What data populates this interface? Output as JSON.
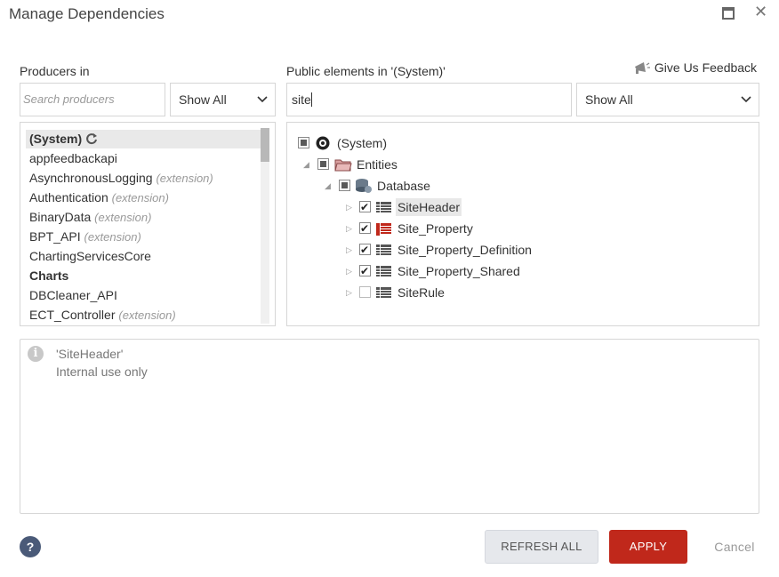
{
  "window": {
    "title": "Manage Dependencies"
  },
  "producers": {
    "label": "Producers in",
    "search_placeholder": "Search producers",
    "filter": "Show All",
    "items": [
      {
        "name": "(System)",
        "ext": ""
      },
      {
        "name": "appfeedbackapi",
        "ext": ""
      },
      {
        "name": "AsynchronousLogging",
        "ext": "(extension)"
      },
      {
        "name": "Authentication",
        "ext": "(extension)"
      },
      {
        "name": "BinaryData",
        "ext": "(extension)"
      },
      {
        "name": "BPT_API",
        "ext": "(extension)"
      },
      {
        "name": "ChartingServicesCore",
        "ext": ""
      },
      {
        "name": "Charts",
        "ext": ""
      },
      {
        "name": "DBCleaner_API",
        "ext": ""
      },
      {
        "name": "ECT_Controller",
        "ext": "(extension)"
      }
    ]
  },
  "elements": {
    "label": "Public elements in '(System)'",
    "search_value": "site",
    "filter": "Show All",
    "feedback": "Give Us Feedback",
    "tree": {
      "root": "(System)",
      "entities": "Entities",
      "database": "Database",
      "tables": [
        "SiteHeader",
        "Site_Property",
        "Site_Property_Definition",
        "Site_Property_Shared",
        "SiteRule"
      ]
    }
  },
  "details": {
    "name": "'SiteHeader'",
    "description": "Internal use only"
  },
  "footer": {
    "help": "?",
    "refresh": "REFRESH ALL",
    "apply": "APPLY",
    "cancel": "Cancel"
  },
  "colors": {
    "apply": "#c0281b",
    "help": "#4a5a78",
    "selection": "#e8e8e8"
  }
}
